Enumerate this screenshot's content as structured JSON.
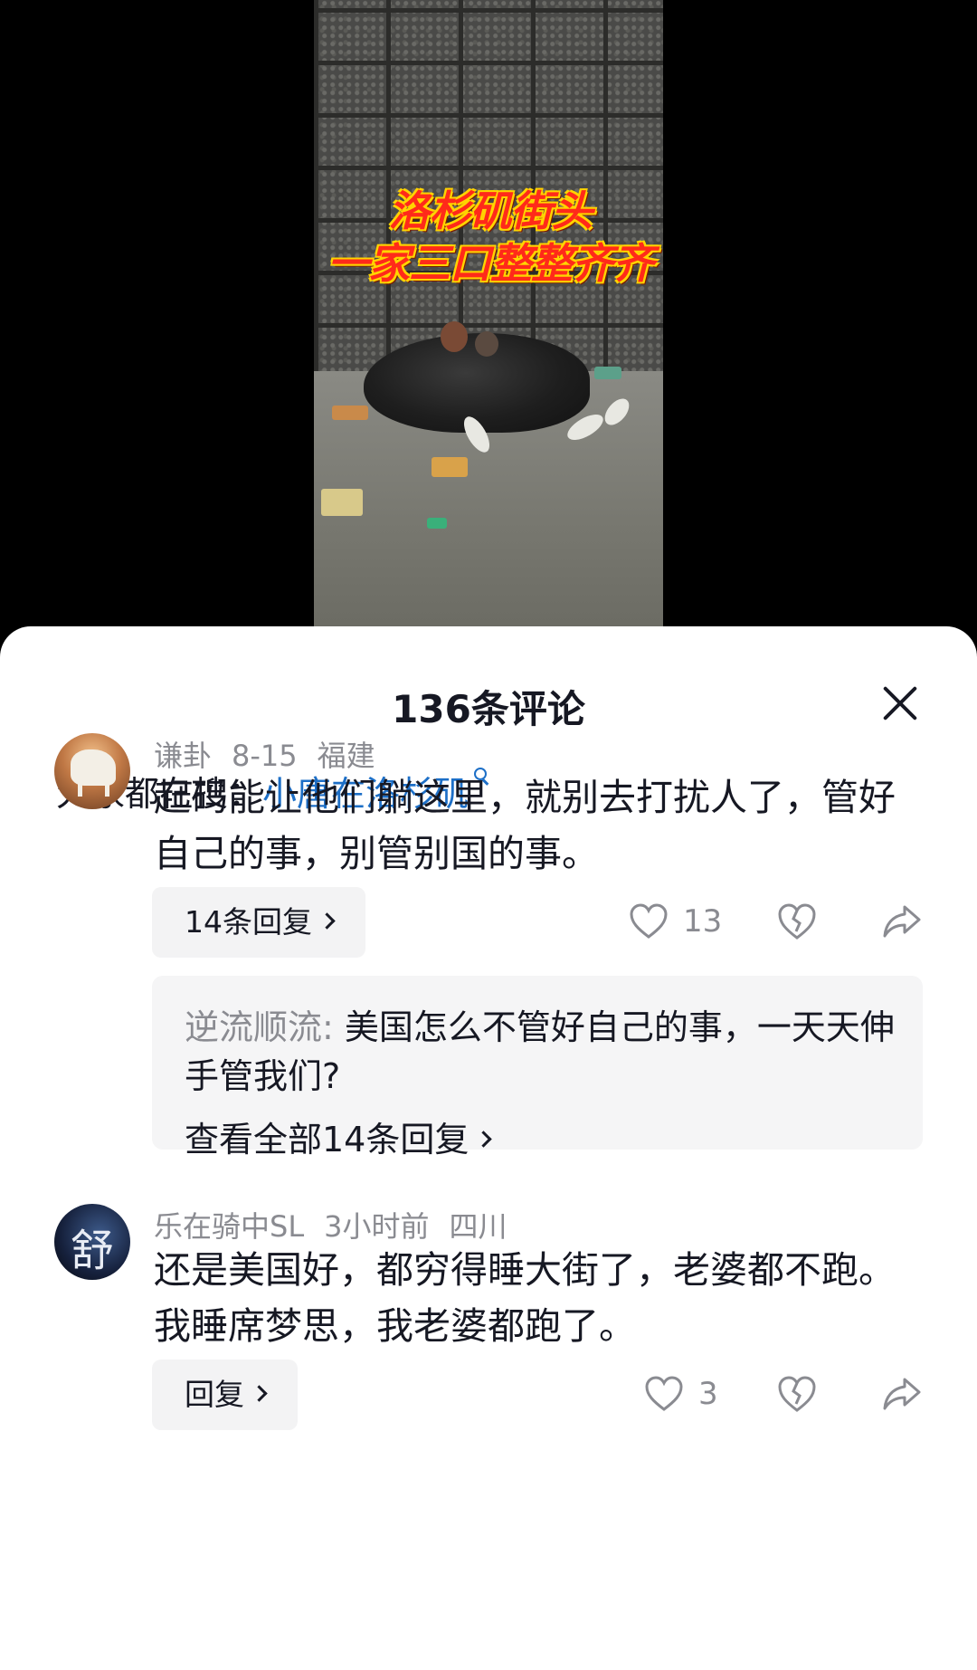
{
  "video": {
    "overlay_line1": "洛杉矶街头",
    "overlay_line2": "一家三口整整齐齐"
  },
  "sheet": {
    "title": "136条评论",
    "close_icon": "close-icon"
  },
  "search": {
    "prefix": "大家都在搜：",
    "query": "小唐在洛杉矶"
  },
  "comments": [
    {
      "username": "谦卦",
      "date": "8-15",
      "location": "福建",
      "text": "起码能让他们躺这里，就别去打扰人了，管好自己的事，别管别国的事。",
      "reply_label": "14条回复",
      "likes": "13",
      "sub_reply": {
        "name": "逆流顺流",
        "text": "美国怎么不管好自己的事，一天天伸手管我们?",
        "view_all": "查看全部14条回复"
      }
    },
    {
      "username": "乐在骑中SL",
      "date": "3小时前",
      "location": "四川",
      "avatar_glyph": "舒",
      "text": "还是美国好，都穷得睡大街了，老婆都不跑。我睡席梦思，我老婆都跑了。",
      "reply_label": "回复",
      "likes": "3"
    }
  ]
}
